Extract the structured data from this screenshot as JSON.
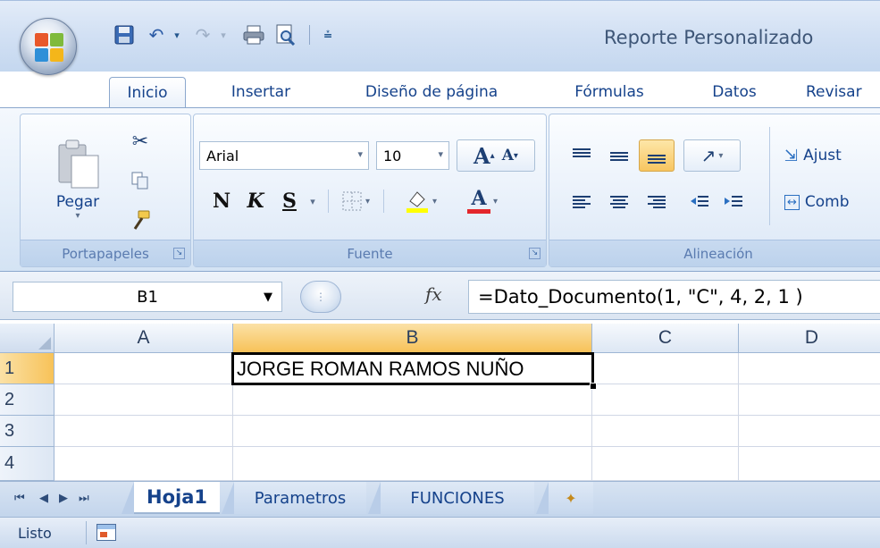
{
  "window": {
    "title": "Reporte Personalizado"
  },
  "quick_access": [
    {
      "name": "save-icon",
      "glyph": "🖫"
    },
    {
      "name": "undo-icon",
      "glyph": "↶"
    },
    {
      "name": "redo-icon",
      "glyph": "↷"
    },
    {
      "name": "print-icon",
      "glyph": "⎙"
    },
    {
      "name": "print-preview-icon",
      "glyph": "🔍"
    },
    {
      "name": "customize-qat-icon",
      "glyph": "≑"
    }
  ],
  "ribbon_tabs": [
    "Inicio",
    "Insertar",
    "Diseño de página",
    "Fórmulas",
    "Datos",
    "Revisar"
  ],
  "active_tab": "Inicio",
  "groups": {
    "clipboard": {
      "label": "Portapapeles",
      "paste_label": "Pegar"
    },
    "font": {
      "label": "Fuente",
      "font_name": "Arial",
      "font_size": "10",
      "grow": "A",
      "shrink": "A",
      "bold": "N",
      "italic": "K",
      "underline": "S",
      "font_color_letter": "A"
    },
    "alignment": {
      "label": "Alineación",
      "wrap_text": "Ajust",
      "merge": "Comb"
    }
  },
  "formula_bar": {
    "name_box": "B1",
    "fx": "fx",
    "formula": "=Dato_Documento(1, \"C\", 4, 2, 1 )"
  },
  "grid": {
    "columns": [
      "A",
      "B",
      "C",
      "D"
    ],
    "selected_column": "B",
    "rows": [
      "1",
      "2",
      "3",
      "4"
    ],
    "selected_row": "1",
    "active_cell": "B1",
    "cells": {
      "B1": "JORGE ROMAN RAMOS NUÑO"
    }
  },
  "sheets": {
    "tabs": [
      "Hoja1",
      "Parametros",
      "FUNCIONES"
    ],
    "active": "Hoja1"
  },
  "status": {
    "text": "Listo"
  },
  "colors": {
    "ribbon_blue": "#dbe7f6",
    "selection_header": "#f7c258",
    "text_blue": "#15428b"
  }
}
